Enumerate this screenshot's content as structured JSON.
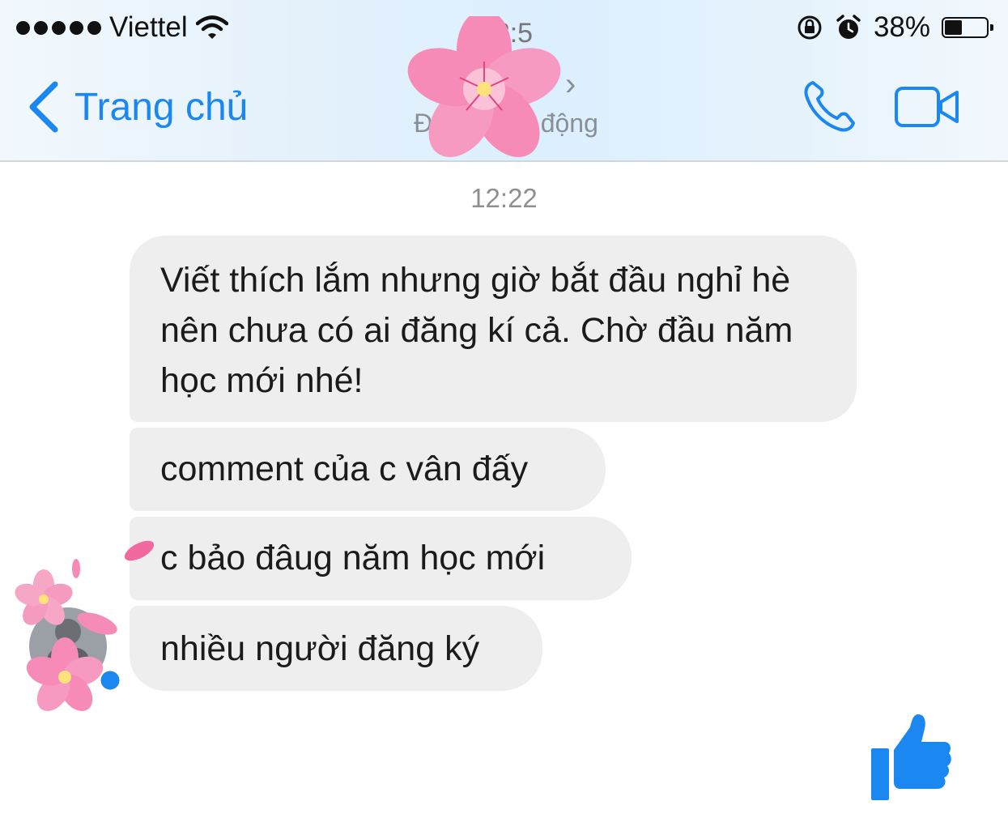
{
  "status_bar": {
    "carrier": "Viettel",
    "battery_percent": "38%",
    "battery_level": 0.38
  },
  "nav": {
    "back_label": "Trang chủ",
    "title_time": "12:5",
    "subtitle": "Đang hoạt động",
    "accent_color": "#1a88f0"
  },
  "conversation": {
    "timestamp": "12:22",
    "messages": [
      {
        "text": "Viết thích lắm nhưng giờ bắt đầu nghỉ hè nên chưa có ai đăng kí cả. Chờ đầu năm học mới nhé!"
      },
      {
        "text": "comment của c vân đấy"
      },
      {
        "text": "c bảo đâug năm  học mới"
      },
      {
        "text": "nhiều người đăng ký"
      }
    ]
  },
  "icons": [
    "signal-dots-icon",
    "wifi-icon",
    "rotation-lock-icon",
    "alarm-icon",
    "battery-icon",
    "back-chevron-icon",
    "phone-icon",
    "video-camera-icon",
    "thumbs-up-icon",
    "flower-sticker-icon"
  ]
}
